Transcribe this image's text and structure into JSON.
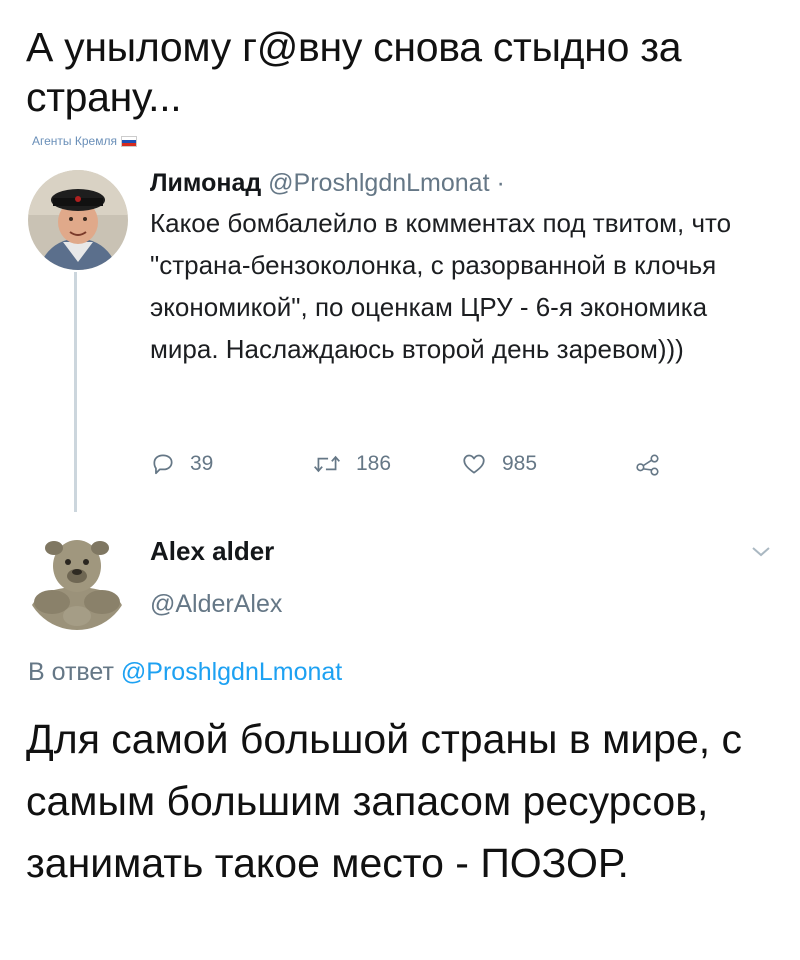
{
  "post": {
    "headline": "А унылому г@вну снова стыдно за страну...",
    "watermark": "Агенты Кремля"
  },
  "quoted_tweet": {
    "name": "Лимонад",
    "handle": "@ProshlgdnLmonat",
    "separator": " ·",
    "text": "Какое бомбалейло в комментах под твитом, что \"страна-бензоколонка, с разорванной в клочья экономикой\", по оценкам ЦРУ - 6-я экономика мира. Наслаждаюсь второй день заревом)))",
    "replies": "39",
    "retweets": "186",
    "likes": "985"
  },
  "reply_tweet": {
    "name": "Alex alder",
    "handle": "@AlderAlex",
    "reply_prefix": "В ответ ",
    "reply_to": "@ProshlgdnLmonat",
    "text": "Для самой большой страны в мире, с самым большим запасом ресурсов, занимать такое место - ПОЗОР."
  },
  "colors": {
    "text": "#14171a",
    "secondary": "#657786",
    "link": "#1da1f2",
    "thread_line": "#ccd6dd"
  },
  "icons": [
    "reply-icon",
    "retweet-icon",
    "like-icon",
    "share-icon",
    "chevron-down-icon"
  ]
}
